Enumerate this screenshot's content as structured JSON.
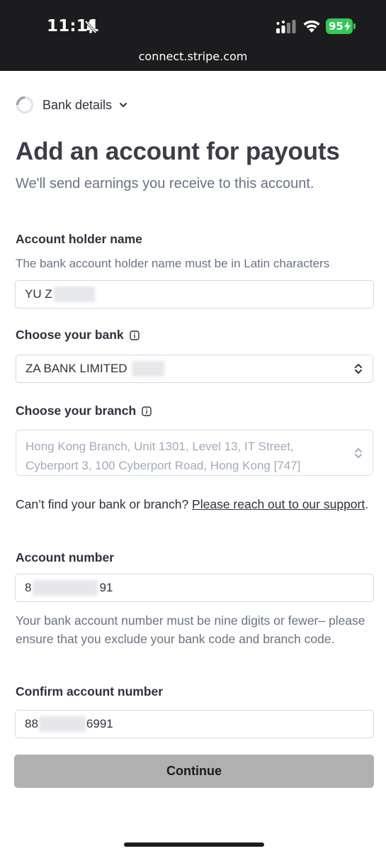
{
  "status_bar": {
    "time": "11:11",
    "battery": "95",
    "url": "connect.stripe.com"
  },
  "step": {
    "label": "Bank details"
  },
  "page": {
    "title": "Add an account for payouts",
    "subtitle": "We'll send earnings you receive to this account."
  },
  "account_holder": {
    "label": "Account holder name",
    "hint": "The bank account holder name must be in Latin characters",
    "value": "YU Z"
  },
  "bank": {
    "label": "Choose your bank",
    "value": "ZA BANK LIMITED"
  },
  "branch": {
    "label": "Choose your branch",
    "value": "Hong Kong Branch, Unit 1301, Level 13, IT Street, Cyberport 3, 100 Cyberport Road, Hong Kong [747]"
  },
  "help": {
    "text": "Can’t find your bank or branch? ",
    "link": "Please reach out to our support",
    "suffix": "."
  },
  "account_number": {
    "label": "Account number",
    "value_prefix": "8",
    "value_suffix": "91",
    "hint": "Your bank account number must be nine digits or fewer– please ensure that you exclude your bank code and branch code."
  },
  "confirm_account": {
    "label": "Confirm account number",
    "value_prefix": "88",
    "value_suffix": "6991"
  },
  "continue_label": "Continue",
  "colors": {
    "status_bar_bg": "#1c1c1e",
    "battery_green": "#34c759",
    "button_disabled": "#b0b0b0",
    "text_primary": "#30313d",
    "text_secondary": "#6a7383"
  }
}
